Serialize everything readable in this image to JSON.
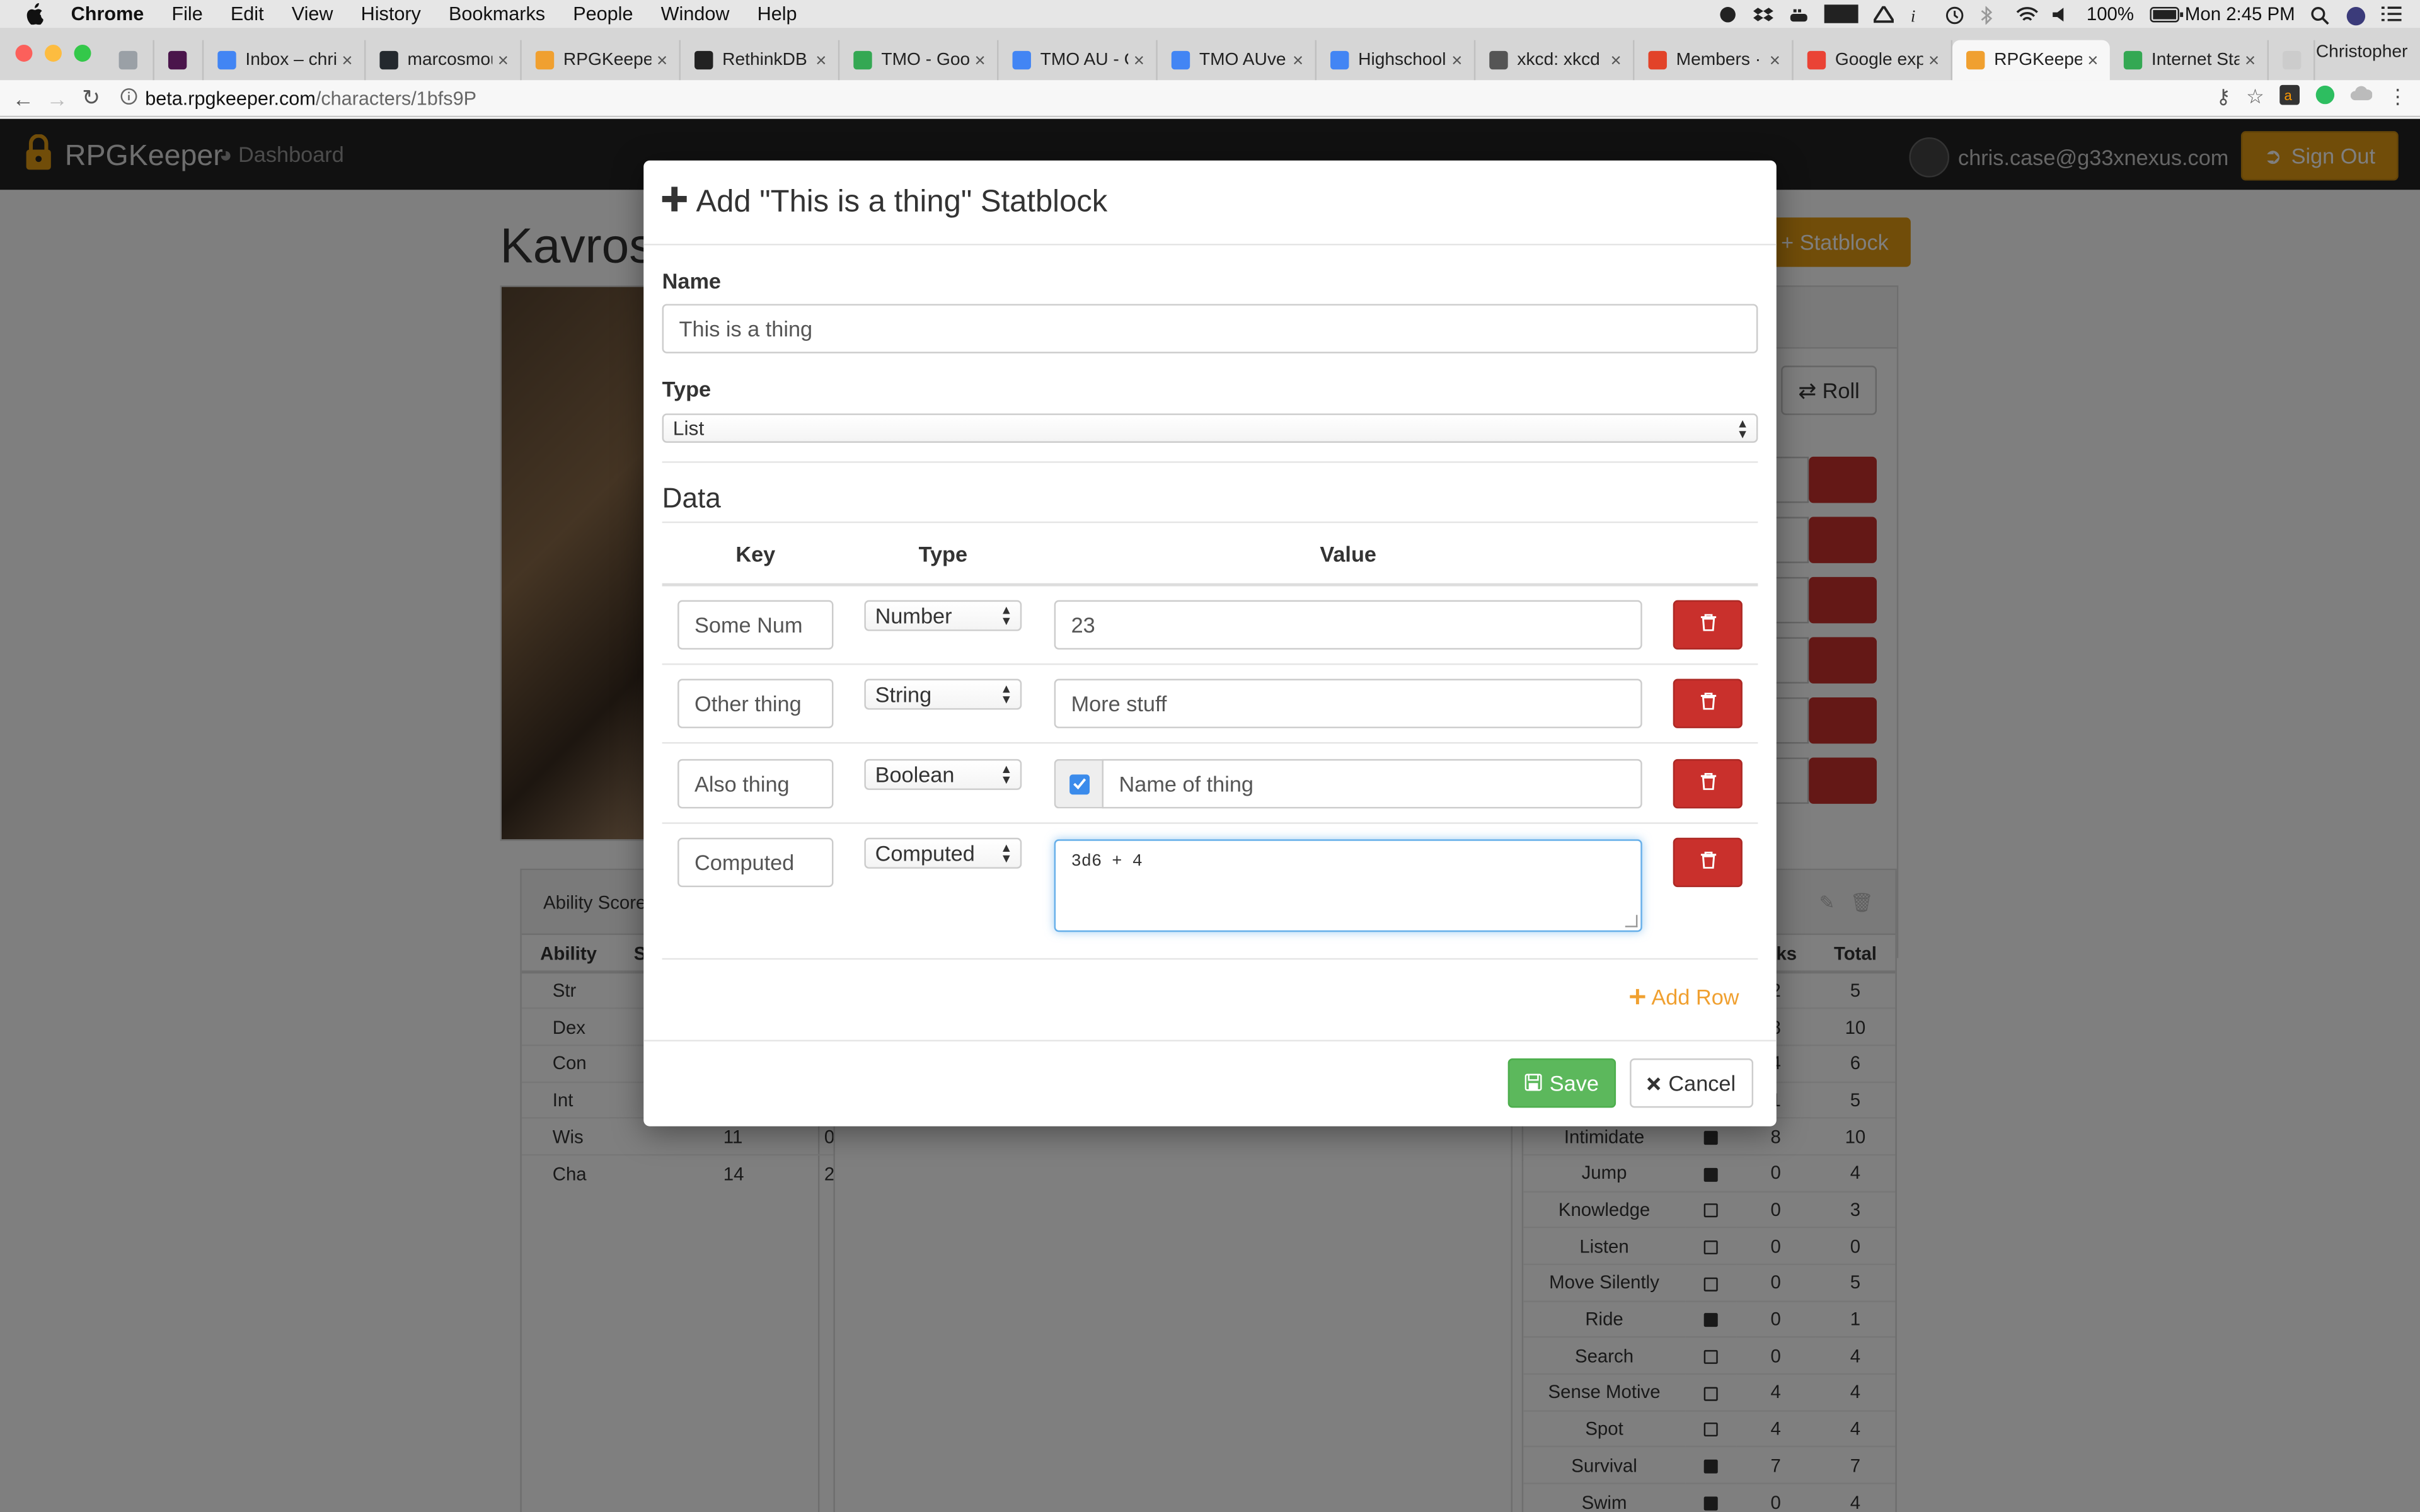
{
  "menubar": {
    "items": [
      "Chrome",
      "File",
      "Edit",
      "View",
      "History",
      "Bookmarks",
      "People",
      "Window",
      "Help"
    ],
    "battery": "100%",
    "clock": "Mon 2:45 PM"
  },
  "browser": {
    "tabs": [
      {
        "label": "",
        "favicon_color": "#9aa0a6"
      },
      {
        "label": "",
        "favicon_color": "#4a154b"
      },
      {
        "label": "Inbox – chris",
        "favicon_color": "#4285f4"
      },
      {
        "label": "marcosmour",
        "favicon_color": "#24292e"
      },
      {
        "label": "RPGKeeper",
        "favicon_color": "#f0a030"
      },
      {
        "label": "RethinkDB A",
        "favicon_color": "#222222"
      },
      {
        "label": "TMO - Goog",
        "favicon_color": "#34a853"
      },
      {
        "label": "TMO AU - C",
        "favicon_color": "#4285f4"
      },
      {
        "label": "TMO AUvers",
        "favicon_color": "#4285f4"
      },
      {
        "label": "Highschool S",
        "favicon_color": "#4285f4"
      },
      {
        "label": "xkcd: xkcd P",
        "favicon_color": "#555555"
      },
      {
        "label": "Members · G",
        "favicon_color": "#e24329"
      },
      {
        "label": "Google expe",
        "favicon_color": "#ea4335"
      },
      {
        "label": "RPGKeeper",
        "favicon_color": "#f0a030"
      },
      {
        "label": "Internet Stat",
        "favicon_color": "#34a853"
      },
      {
        "label": "",
        "favicon_color": "#cccccc"
      }
    ],
    "active_tab_index": 13,
    "profile_name": "Christopher",
    "url_host": "beta.rpgkeeper.com",
    "url_path": "/characters/1bfs9P"
  },
  "site": {
    "brand": "RPGKeeper",
    "dashboard_link": "Dashboard",
    "user_email": "chris.case@g33xnexus.com",
    "sign_out": "Sign Out",
    "accent": "#e39a12"
  },
  "background": {
    "character_title": "Kavros",
    "statblock_button": "Statblock",
    "roll_button": "Roll",
    "ability_panel_title": "Ability Score",
    "ability_headers": [
      "Ability",
      "S"
    ],
    "abilities": [
      {
        "name": "Str",
        "score": "",
        "mod": ""
      },
      {
        "name": "Dex",
        "score": "",
        "mod": ""
      },
      {
        "name": "Con",
        "score": "",
        "mod": ""
      },
      {
        "name": "Int",
        "score": "",
        "mod": ""
      },
      {
        "name": "Wis",
        "score": "11",
        "mod": "0"
      },
      {
        "name": "Cha",
        "score": "14",
        "mod": "2"
      }
    ],
    "skill_headers": [
      "anks",
      "Total"
    ],
    "skills": [
      {
        "name": "",
        "class": false,
        "ranks": "2",
        "total": "5"
      },
      {
        "name": "",
        "class": false,
        "ranks": "8",
        "total": "10"
      },
      {
        "name": "",
        "class": false,
        "ranks": "4",
        "total": "6"
      },
      {
        "name": "",
        "class": false,
        "ranks": "1",
        "total": "5"
      },
      {
        "name": "Intimidate",
        "class": true,
        "ranks": "8",
        "total": "10"
      },
      {
        "name": "Jump",
        "class": true,
        "ranks": "0",
        "total": "4"
      },
      {
        "name": "Knowledge",
        "class": false,
        "ranks": "0",
        "total": "3"
      },
      {
        "name": "Listen",
        "class": false,
        "ranks": "0",
        "total": "0"
      },
      {
        "name": "Move Silently",
        "class": false,
        "ranks": "0",
        "total": "5"
      },
      {
        "name": "Ride",
        "class": true,
        "ranks": "0",
        "total": "1"
      },
      {
        "name": "Search",
        "class": false,
        "ranks": "0",
        "total": "4"
      },
      {
        "name": "Sense Motive",
        "class": false,
        "ranks": "4",
        "total": "4"
      },
      {
        "name": "Spot",
        "class": false,
        "ranks": "4",
        "total": "4"
      },
      {
        "name": "Survival",
        "class": true,
        "ranks": "7",
        "total": "7"
      },
      {
        "name": "Swim",
        "class": true,
        "ranks": "0",
        "total": "4"
      }
    ]
  },
  "modal": {
    "title": "Add \"This is a thing\" Statblock",
    "name_label": "Name",
    "name_value": "This is a thing",
    "type_label": "Type",
    "type_value": "List",
    "data_heading": "Data",
    "columns": {
      "key": "Key",
      "type": "Type",
      "value": "Value"
    },
    "rows": [
      {
        "key": "Some Num",
        "type": "Number",
        "value": "23"
      },
      {
        "key": "Other thing",
        "type": "String",
        "value": "More stuff"
      },
      {
        "key": "Also thing",
        "type": "Boolean",
        "value": "Name of thing",
        "checked": true
      },
      {
        "key": "Computed",
        "type": "Computed",
        "value": "3d6 + 4"
      }
    ],
    "add_row": "Add Row",
    "save": "Save",
    "cancel": "Cancel",
    "danger_color": "#c9302c",
    "success_color": "#5cb85c"
  }
}
